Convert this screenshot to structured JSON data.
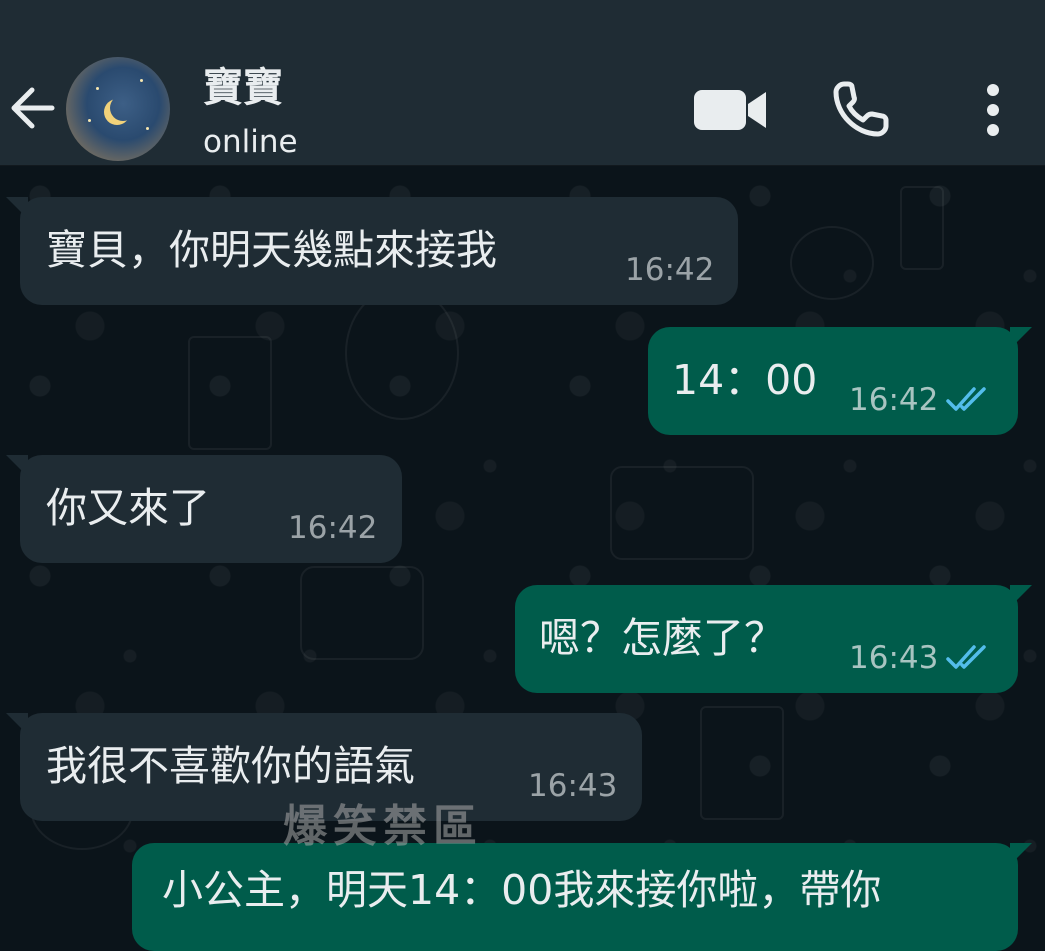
{
  "contact": {
    "name": "寶寶",
    "status": "online"
  },
  "header_icons": [
    "back-arrow-icon",
    "video-call-icon",
    "phone-call-icon",
    "more-options-icon"
  ],
  "colors": {
    "header": "#1f2c34",
    "chat_bg": "#0b141a",
    "incoming_bubble": "#1f2c34",
    "outgoing_bubble": "#005c4b",
    "read_tick": "#53bdeb"
  },
  "messages": [
    {
      "direction": "incoming",
      "text": "寶貝，你明天幾點來接我",
      "time": "16:42"
    },
    {
      "direction": "outgoing",
      "text": "14：00",
      "time": "16:42",
      "status": "read"
    },
    {
      "direction": "incoming",
      "text": "你又來了",
      "time": "16:42"
    },
    {
      "direction": "outgoing",
      "text": "嗯？怎麼了？",
      "time": "16:43",
      "status": "read"
    },
    {
      "direction": "incoming",
      "text": "我很不喜歡你的語氣",
      "time": "16:43"
    },
    {
      "direction": "outgoing",
      "text": "小公主，明天14：00我來接你啦，帶你",
      "time": "",
      "status": ""
    }
  ],
  "watermark": "爆笑禁區"
}
